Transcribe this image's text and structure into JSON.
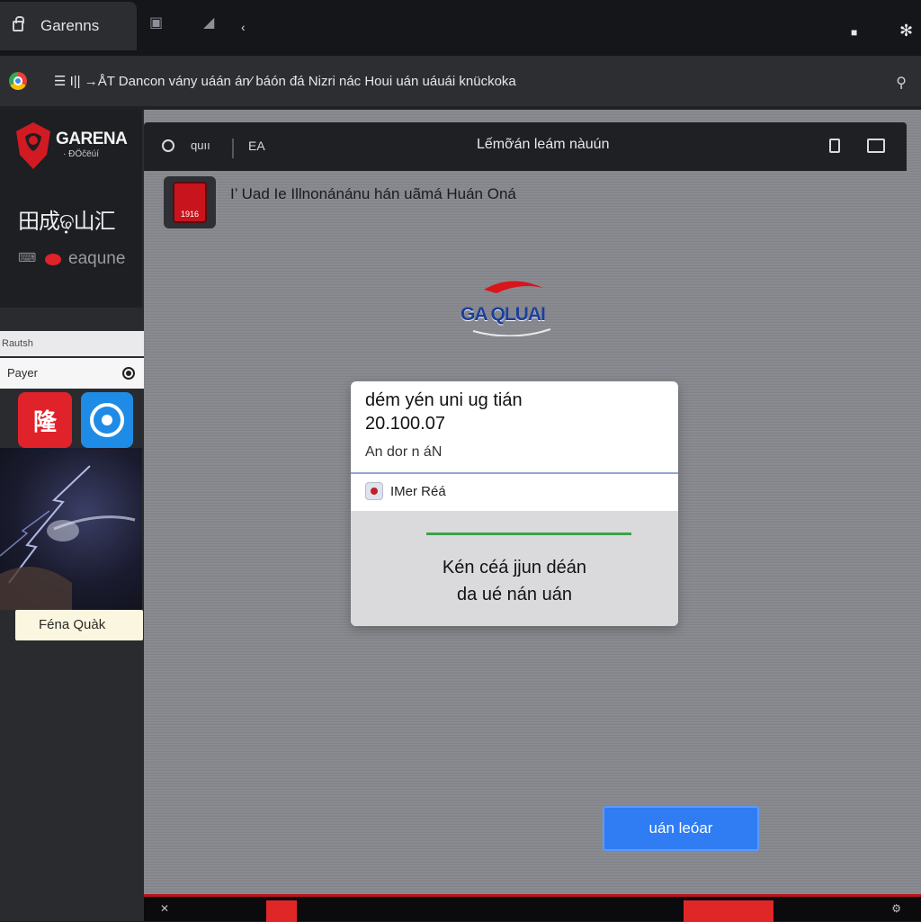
{
  "tab": {
    "title": "Garenns"
  },
  "address": {
    "url": "☰ I|| →ÅT Dancon vány uáán án⁄ báón đá Nizri nác Houi uán uáuái knückoka"
  },
  "sidebar": {
    "brand_name": "GARENA",
    "brand_sub": "· ÐÖĉёúí",
    "title": "田成ଢ଼山汇",
    "game_label": "eaqune",
    "search_label": "Rautsh",
    "player_label": "Payer",
    "red_app_label": "隆",
    "tag_label": "Féna Quàk"
  },
  "header": {
    "left_label": "quıı",
    "ea_label": "EA",
    "title": "Lếmỡán leám nàuún"
  },
  "notice": {
    "text": "I’ Uad Ie Illnonánánu hán uãmá Huán Oná",
    "icon_label": "1916"
  },
  "center_brand": {
    "text": "GA QLUAI"
  },
  "dialog": {
    "title": "dém yén uni ug tián",
    "value": "20.100.07",
    "subtitle": "An dor n áN",
    "account": "IMer Réá",
    "progress": 1.0,
    "message_line1": "Kén céá jjun déán",
    "message_line2": "da ué nán uán"
  },
  "primary_button": {
    "label": "uán leóar"
  },
  "colors": {
    "accent_blue": "#2f7cf3",
    "brand_red": "#e0222a",
    "progress_green": "#3aa34b",
    "tag_bg": "#fbf6df"
  },
  "icons": [
    "lock-icon",
    "chrome-icon",
    "circle-icon",
    "target-icon",
    "ring-icon",
    "external-icon",
    "screen-icon"
  ]
}
